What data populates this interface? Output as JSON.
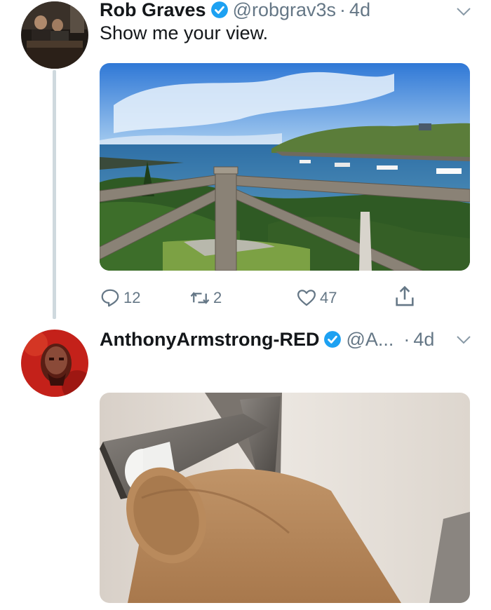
{
  "tweets": [
    {
      "name": "Rob Graves",
      "handle": "@robgrav3s",
      "separator": "·",
      "time": "4d",
      "text": "Show me your view.",
      "actions": {
        "replies": "12",
        "retweets": "2",
        "likes": "47"
      }
    },
    {
      "name": "AnthonyArmstrong-RED",
      "handle": "@A...",
      "separator": "·",
      "time": "4d"
    }
  ],
  "colors": {
    "verified": "#1da1f2",
    "secondary_text": "#657786",
    "thread_line": "#cfd9de"
  }
}
